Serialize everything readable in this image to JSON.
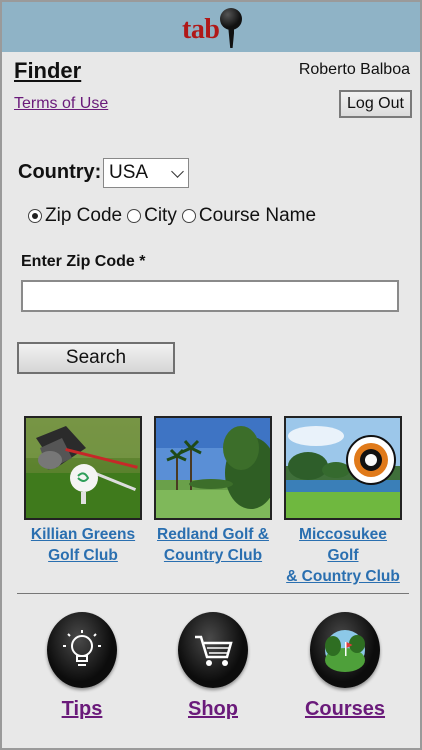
{
  "header": {
    "logo_text": "tab"
  },
  "page": {
    "title": "Finder",
    "user_name": "Roberto Balboa",
    "terms_link": "Terms of Use",
    "logout_label": "Log Out"
  },
  "search_form": {
    "country_label": "Country:",
    "country_value": "USA",
    "search_by_options": [
      {
        "label": "Zip Code",
        "selected": true
      },
      {
        "label": "City",
        "selected": false
      },
      {
        "label": "Course Name",
        "selected": false
      }
    ],
    "zip_label": "Enter Zip Code *",
    "zip_value": "",
    "search_button": "Search"
  },
  "courses": [
    {
      "name_line1": "Killian Greens",
      "name_line2": "Golf Club",
      "image": "golf-ball-on-tee-photo"
    },
    {
      "name_line1": "Redland Golf &",
      "name_line2": "Country Club",
      "image": "palm-trees-fairway-photo"
    },
    {
      "name_line1": "Miccosukee Golf",
      "name_line2": "& Country Club",
      "image": "lake-and-logo-photo"
    }
  ],
  "bottom_nav": [
    {
      "label": "Tips",
      "icon": "lightbulb-icon"
    },
    {
      "label": "Shop",
      "icon": "cart-icon"
    },
    {
      "label": "Courses",
      "icon": "golf-course-icon"
    }
  ],
  "colors": {
    "topbar": "#8fb3c6",
    "logo_red": "#b01818",
    "link_purple": "#6a1a7a",
    "course_link_blue": "#2a6fb0",
    "page_background": "#e8e8e8"
  }
}
